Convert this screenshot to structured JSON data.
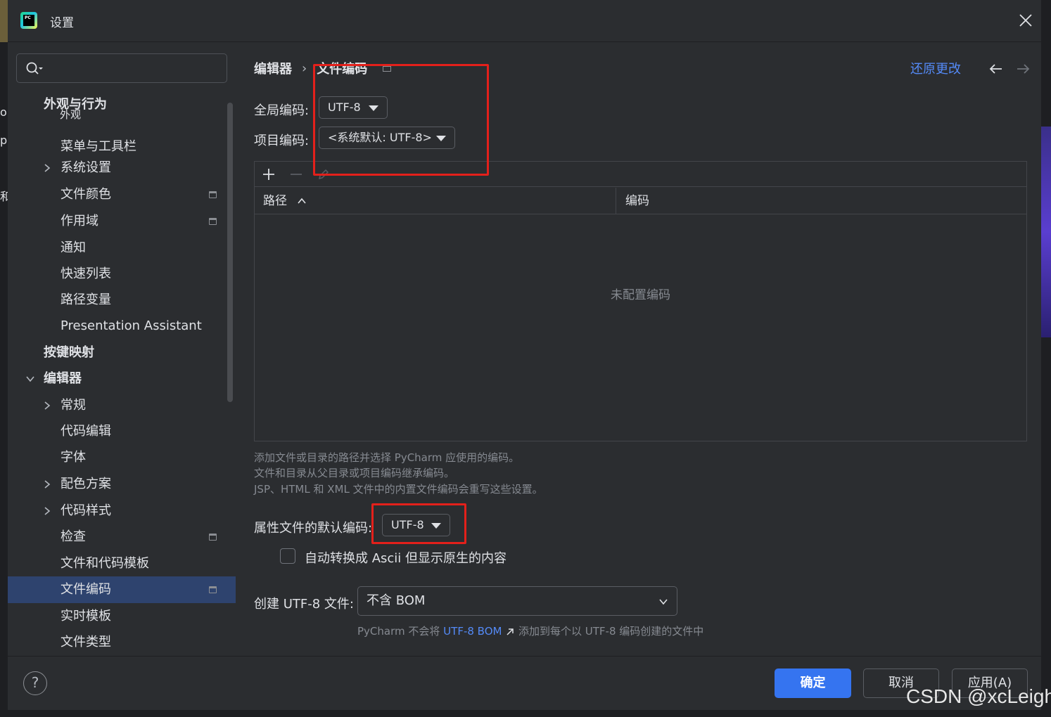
{
  "window": {
    "title": "设置",
    "logo_text": "PC"
  },
  "search": {
    "placeholder": ""
  },
  "sidebar": {
    "items": [
      {
        "label": "外观与行为",
        "bold": true
      },
      {
        "label": "外观"
      },
      {
        "label": "菜单与工具栏"
      },
      {
        "label": "系统设置",
        "expandable": true
      },
      {
        "label": "文件颜色",
        "pinned": true
      },
      {
        "label": "作用域",
        "pinned": true
      },
      {
        "label": "通知"
      },
      {
        "label": "快速列表"
      },
      {
        "label": "路径变量"
      },
      {
        "label": "Presentation Assistant"
      },
      {
        "label": "按键映射",
        "bold": true
      },
      {
        "label": "编辑器",
        "bold": true,
        "expanded": true
      },
      {
        "label": "常规",
        "expandable": true
      },
      {
        "label": "代码编辑"
      },
      {
        "label": "字体"
      },
      {
        "label": "配色方案",
        "expandable": true
      },
      {
        "label": "代码样式",
        "expandable": true
      },
      {
        "label": "检查",
        "pinned": true
      },
      {
        "label": "文件和代码模板"
      },
      {
        "label": "文件编码",
        "pinned": true,
        "selected": true
      },
      {
        "label": "实时模板"
      },
      {
        "label": "文件类型"
      }
    ]
  },
  "breadcrumb": {
    "parent": "编辑器",
    "separator": "›",
    "current": "文件编码"
  },
  "header": {
    "reset_label": "还原更改"
  },
  "encoding": {
    "global_label": "全局编码:",
    "global_value": "UTF-8",
    "project_label": "项目编码:",
    "project_value": "<系统默认: UTF-8>"
  },
  "table": {
    "columns": [
      "路径",
      "编码"
    ],
    "empty_text": "未配置编码"
  },
  "hints": [
    "添加文件或目录的路径并选择 PyCharm 应使用的编码。",
    "文件和目录从父目录或项目编码继承编码。",
    "JSP、HTML 和 XML 文件中的内置文件编码会重写这些设置。"
  ],
  "properties": {
    "label": "属性文件的默认编码:",
    "value": "UTF-8",
    "checkbox_label": "自动转换成 Ascii 但显示原生的内容",
    "checkbox_checked": false
  },
  "bom": {
    "label": "创建 UTF-8 文件:",
    "value": "不含 BOM",
    "hint_before": "PyCharm 不会将",
    "hint_link": "UTF-8 BOM",
    "hint_after": "添加到每个以 UTF-8 编码创建的文件中"
  },
  "footer": {
    "help_label": "?",
    "ok_label": "确定",
    "cancel_label": "取消",
    "apply_label": "应用(A)"
  },
  "watermark": "CSDN @xcLeigh",
  "colors": {
    "accent": "#3574f0",
    "link": "#548af7",
    "highlight_box": "#e3201b",
    "selection": "#2e436e"
  }
}
